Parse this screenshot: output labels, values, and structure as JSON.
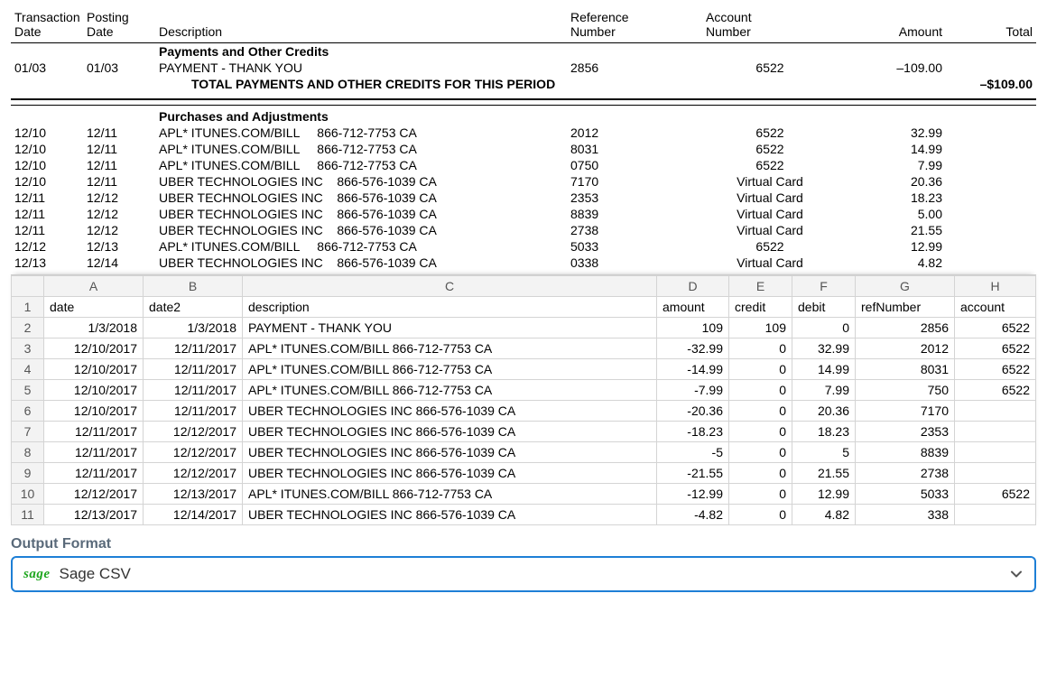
{
  "statement": {
    "headers": {
      "transDate": "Transaction\nDate",
      "postDate": "Posting\nDate",
      "description": "Description",
      "refNum": "Reference\nNumber",
      "acctNum": "Account\nNumber",
      "amount": "Amount",
      "total": "Total"
    },
    "sections": [
      {
        "title": "Payments and Other Credits",
        "rows": [
          {
            "tdate": "01/03",
            "pdate": "01/03",
            "desc": "PAYMENT - THANK YOU",
            "ref": "2856",
            "acct": "6522",
            "amount": "–109.00"
          }
        ],
        "subtotalLabel": "TOTAL PAYMENTS AND OTHER CREDITS FOR THIS PERIOD",
        "subtotalAmount": "–$109.00"
      },
      {
        "title": "Purchases and Adjustments",
        "rows": [
          {
            "tdate": "12/10",
            "pdate": "12/11",
            "desc": "APL* ITUNES.COM/BILL     866-712-7753 CA",
            "ref": "2012",
            "acct": "6522",
            "amount": "32.99"
          },
          {
            "tdate": "12/10",
            "pdate": "12/11",
            "desc": "APL* ITUNES.COM/BILL     866-712-7753 CA",
            "ref": "8031",
            "acct": "6522",
            "amount": "14.99"
          },
          {
            "tdate": "12/10",
            "pdate": "12/11",
            "desc": "APL* ITUNES.COM/BILL     866-712-7753 CA",
            "ref": "0750",
            "acct": "6522",
            "amount": "7.99"
          },
          {
            "tdate": "12/10",
            "pdate": "12/11",
            "desc": "UBER TECHNOLOGIES INC    866-576-1039 CA",
            "ref": "7170",
            "acct": "Virtual Card",
            "amount": "20.36"
          },
          {
            "tdate": "12/11",
            "pdate": "12/12",
            "desc": "UBER TECHNOLOGIES INC    866-576-1039 CA",
            "ref": "2353",
            "acct": "Virtual Card",
            "amount": "18.23"
          },
          {
            "tdate": "12/11",
            "pdate": "12/12",
            "desc": "UBER TECHNOLOGIES INC    866-576-1039 CA",
            "ref": "8839",
            "acct": "Virtual Card",
            "amount": "5.00"
          },
          {
            "tdate": "12/11",
            "pdate": "12/12",
            "desc": "UBER TECHNOLOGIES INC    866-576-1039 CA",
            "ref": "2738",
            "acct": "Virtual Card",
            "amount": "21.55"
          },
          {
            "tdate": "12/12",
            "pdate": "12/13",
            "desc": "APL* ITUNES.COM/BILL     866-712-7753 CA",
            "ref": "5033",
            "acct": "6522",
            "amount": "12.99"
          },
          {
            "tdate": "12/13",
            "pdate": "12/14",
            "desc": "UBER TECHNOLOGIES INC    866-576-1039 CA",
            "ref": "0338",
            "acct": "Virtual Card",
            "amount": "4.82"
          }
        ]
      }
    ]
  },
  "sheet": {
    "columns": [
      "A",
      "B",
      "C",
      "D",
      "E",
      "F",
      "G",
      "H"
    ],
    "header": [
      "date",
      "date2",
      "description",
      "amount",
      "credit",
      "debit",
      "refNumber",
      "account"
    ],
    "rows": [
      [
        "1/3/2018",
        "1/3/2018",
        "PAYMENT - THANK YOU",
        "109",
        "109",
        "0",
        "2856",
        "6522"
      ],
      [
        "12/10/2017",
        "12/11/2017",
        "APL* ITUNES.COM/BILL 866-712-7753 CA",
        "-32.99",
        "0",
        "32.99",
        "2012",
        "6522"
      ],
      [
        "12/10/2017",
        "12/11/2017",
        "APL* ITUNES.COM/BILL 866-712-7753 CA",
        "-14.99",
        "0",
        "14.99",
        "8031",
        "6522"
      ],
      [
        "12/10/2017",
        "12/11/2017",
        "APL* ITUNES.COM/BILL 866-712-7753 CA",
        "-7.99",
        "0",
        "7.99",
        "750",
        "6522"
      ],
      [
        "12/10/2017",
        "12/11/2017",
        "UBER TECHNOLOGIES INC 866-576-1039 CA",
        "-20.36",
        "0",
        "20.36",
        "7170",
        ""
      ],
      [
        "12/11/2017",
        "12/12/2017",
        "UBER TECHNOLOGIES INC 866-576-1039 CA",
        "-18.23",
        "0",
        "18.23",
        "2353",
        ""
      ],
      [
        "12/11/2017",
        "12/12/2017",
        "UBER TECHNOLOGIES INC 866-576-1039 CA",
        "-5",
        "0",
        "5",
        "8839",
        ""
      ],
      [
        "12/11/2017",
        "12/12/2017",
        "UBER TECHNOLOGIES INC 866-576-1039 CA",
        "-21.55",
        "0",
        "21.55",
        "2738",
        ""
      ],
      [
        "12/12/2017",
        "12/13/2017",
        "APL* ITUNES.COM/BILL 866-712-7753 CA",
        "-12.99",
        "0",
        "12.99",
        "5033",
        "6522"
      ],
      [
        "12/13/2017",
        "12/14/2017",
        "UBER TECHNOLOGIES INC 866-576-1039 CA",
        "-4.82",
        "0",
        "4.82",
        "338",
        ""
      ]
    ]
  },
  "outputFormat": {
    "label": "Output Format",
    "logoText": "sage",
    "value": "Sage CSV"
  }
}
